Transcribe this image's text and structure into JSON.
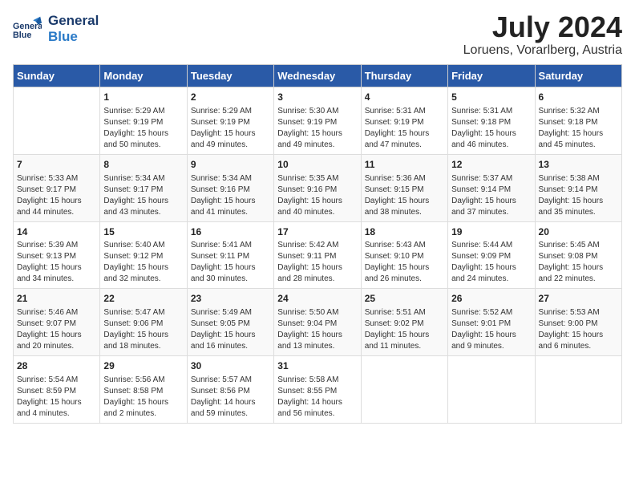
{
  "logo": {
    "line1": "General",
    "line2": "Blue"
  },
  "title": {
    "month_year": "July 2024",
    "location": "Loruens, Vorarlberg, Austria"
  },
  "weekdays": [
    "Sunday",
    "Monday",
    "Tuesday",
    "Wednesday",
    "Thursday",
    "Friday",
    "Saturday"
  ],
  "weeks": [
    [
      {
        "day": "",
        "info": ""
      },
      {
        "day": "1",
        "info": "Sunrise: 5:29 AM\nSunset: 9:19 PM\nDaylight: 15 hours\nand 50 minutes."
      },
      {
        "day": "2",
        "info": "Sunrise: 5:29 AM\nSunset: 9:19 PM\nDaylight: 15 hours\nand 49 minutes."
      },
      {
        "day": "3",
        "info": "Sunrise: 5:30 AM\nSunset: 9:19 PM\nDaylight: 15 hours\nand 49 minutes."
      },
      {
        "day": "4",
        "info": "Sunrise: 5:31 AM\nSunset: 9:19 PM\nDaylight: 15 hours\nand 47 minutes."
      },
      {
        "day": "5",
        "info": "Sunrise: 5:31 AM\nSunset: 9:18 PM\nDaylight: 15 hours\nand 46 minutes."
      },
      {
        "day": "6",
        "info": "Sunrise: 5:32 AM\nSunset: 9:18 PM\nDaylight: 15 hours\nand 45 minutes."
      }
    ],
    [
      {
        "day": "7",
        "info": "Sunrise: 5:33 AM\nSunset: 9:17 PM\nDaylight: 15 hours\nand 44 minutes."
      },
      {
        "day": "8",
        "info": "Sunrise: 5:34 AM\nSunset: 9:17 PM\nDaylight: 15 hours\nand 43 minutes."
      },
      {
        "day": "9",
        "info": "Sunrise: 5:34 AM\nSunset: 9:16 PM\nDaylight: 15 hours\nand 41 minutes."
      },
      {
        "day": "10",
        "info": "Sunrise: 5:35 AM\nSunset: 9:16 PM\nDaylight: 15 hours\nand 40 minutes."
      },
      {
        "day": "11",
        "info": "Sunrise: 5:36 AM\nSunset: 9:15 PM\nDaylight: 15 hours\nand 38 minutes."
      },
      {
        "day": "12",
        "info": "Sunrise: 5:37 AM\nSunset: 9:14 PM\nDaylight: 15 hours\nand 37 minutes."
      },
      {
        "day": "13",
        "info": "Sunrise: 5:38 AM\nSunset: 9:14 PM\nDaylight: 15 hours\nand 35 minutes."
      }
    ],
    [
      {
        "day": "14",
        "info": "Sunrise: 5:39 AM\nSunset: 9:13 PM\nDaylight: 15 hours\nand 34 minutes."
      },
      {
        "day": "15",
        "info": "Sunrise: 5:40 AM\nSunset: 9:12 PM\nDaylight: 15 hours\nand 32 minutes."
      },
      {
        "day": "16",
        "info": "Sunrise: 5:41 AM\nSunset: 9:11 PM\nDaylight: 15 hours\nand 30 minutes."
      },
      {
        "day": "17",
        "info": "Sunrise: 5:42 AM\nSunset: 9:11 PM\nDaylight: 15 hours\nand 28 minutes."
      },
      {
        "day": "18",
        "info": "Sunrise: 5:43 AM\nSunset: 9:10 PM\nDaylight: 15 hours\nand 26 minutes."
      },
      {
        "day": "19",
        "info": "Sunrise: 5:44 AM\nSunset: 9:09 PM\nDaylight: 15 hours\nand 24 minutes."
      },
      {
        "day": "20",
        "info": "Sunrise: 5:45 AM\nSunset: 9:08 PM\nDaylight: 15 hours\nand 22 minutes."
      }
    ],
    [
      {
        "day": "21",
        "info": "Sunrise: 5:46 AM\nSunset: 9:07 PM\nDaylight: 15 hours\nand 20 minutes."
      },
      {
        "day": "22",
        "info": "Sunrise: 5:47 AM\nSunset: 9:06 PM\nDaylight: 15 hours\nand 18 minutes."
      },
      {
        "day": "23",
        "info": "Sunrise: 5:49 AM\nSunset: 9:05 PM\nDaylight: 15 hours\nand 16 minutes."
      },
      {
        "day": "24",
        "info": "Sunrise: 5:50 AM\nSunset: 9:04 PM\nDaylight: 15 hours\nand 13 minutes."
      },
      {
        "day": "25",
        "info": "Sunrise: 5:51 AM\nSunset: 9:02 PM\nDaylight: 15 hours\nand 11 minutes."
      },
      {
        "day": "26",
        "info": "Sunrise: 5:52 AM\nSunset: 9:01 PM\nDaylight: 15 hours\nand 9 minutes."
      },
      {
        "day": "27",
        "info": "Sunrise: 5:53 AM\nSunset: 9:00 PM\nDaylight: 15 hours\nand 6 minutes."
      }
    ],
    [
      {
        "day": "28",
        "info": "Sunrise: 5:54 AM\nSunset: 8:59 PM\nDaylight: 15 hours\nand 4 minutes."
      },
      {
        "day": "29",
        "info": "Sunrise: 5:56 AM\nSunset: 8:58 PM\nDaylight: 15 hours\nand 2 minutes."
      },
      {
        "day": "30",
        "info": "Sunrise: 5:57 AM\nSunset: 8:56 PM\nDaylight: 14 hours\nand 59 minutes."
      },
      {
        "day": "31",
        "info": "Sunrise: 5:58 AM\nSunset: 8:55 PM\nDaylight: 14 hours\nand 56 minutes."
      },
      {
        "day": "",
        "info": ""
      },
      {
        "day": "",
        "info": ""
      },
      {
        "day": "",
        "info": ""
      }
    ]
  ]
}
